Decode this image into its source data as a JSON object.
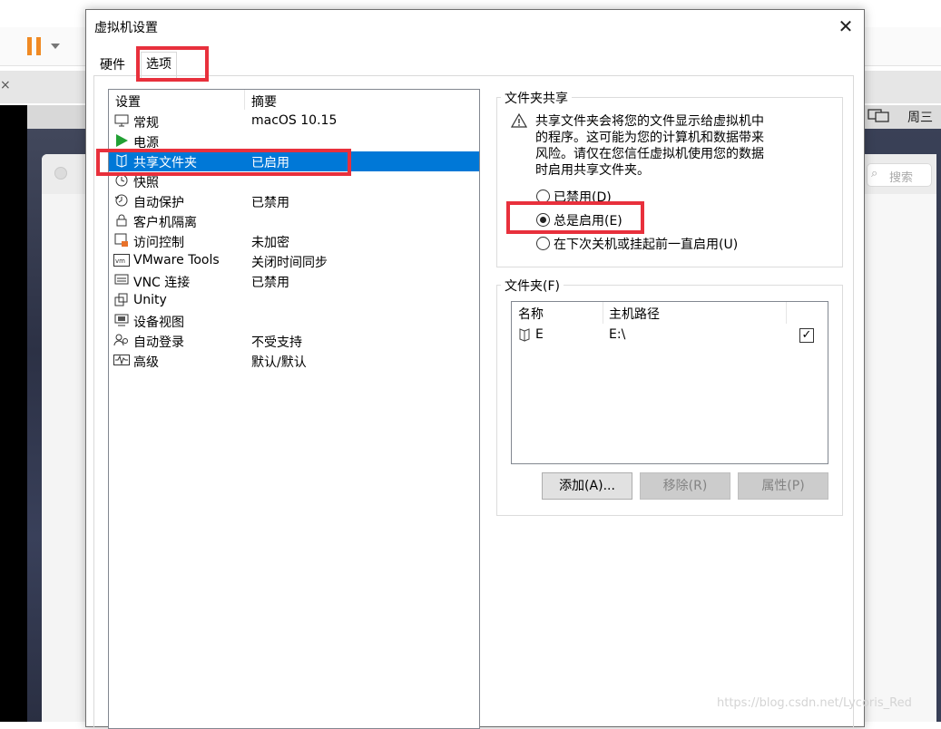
{
  "background": {
    "tab_close_glyph": "×",
    "apple_glyph": "",
    "weekday": "周三",
    "search_placeholder": "搜索"
  },
  "dialog": {
    "title": "虚拟机设置",
    "close_glyph": "✕",
    "tabs": [
      {
        "label": "硬件",
        "active": false
      },
      {
        "label": "选项",
        "active": true
      }
    ],
    "settings_list": {
      "headers": {
        "setting": "设置",
        "summary": "摘要"
      },
      "rows": [
        {
          "icon": "monitor-icon",
          "name": "常规",
          "summary": "macOS 10.15",
          "selected": false
        },
        {
          "icon": "power-play-icon",
          "name": "电源",
          "summary": "",
          "selected": false
        },
        {
          "icon": "shared-folder-icon",
          "name": "共享文件夹",
          "summary": "已启用",
          "selected": true
        },
        {
          "icon": "snapshot-clock-icon",
          "name": "快照",
          "summary": "",
          "selected": false
        },
        {
          "icon": "autoprotect-clock-icon",
          "name": "自动保护",
          "summary": "已禁用",
          "selected": false
        },
        {
          "icon": "lock-icon",
          "name": "客户机隔离",
          "summary": "",
          "selected": false
        },
        {
          "icon": "access-control-icon",
          "name": "访问控制",
          "summary": "未加密",
          "selected": false
        },
        {
          "icon": "vmware-tools-icon",
          "name": "VMware Tools",
          "summary": "关闭时间同步",
          "selected": false
        },
        {
          "icon": "vnc-icon",
          "name": "VNC 连接",
          "summary": "已禁用",
          "selected": false
        },
        {
          "icon": "unity-icon",
          "name": "Unity",
          "summary": "",
          "selected": false
        },
        {
          "icon": "device-view-icon",
          "name": "设备视图",
          "summary": "",
          "selected": false
        },
        {
          "icon": "autologin-users-icon",
          "name": "自动登录",
          "summary": "不受支持",
          "selected": false
        },
        {
          "icon": "advanced-waveform-icon",
          "name": "高级",
          "summary": "默认/默认",
          "selected": false
        }
      ]
    },
    "folder_sharing": {
      "group_label": "文件夹共享",
      "warning_icon": "warning-icon",
      "warning_text": [
        "共享文件夹会将您的文件显示给虚拟机中",
        "的程序。这可能为您的计算机和数据带来",
        "风险。请仅在您信任虚拟机使用您的数据",
        "时启用共享文件夹。"
      ],
      "options": [
        {
          "label": "已禁用(D)",
          "checked": false
        },
        {
          "label": "总是启用(E)",
          "checked": true
        },
        {
          "label": "在下次关机或挂起前一直启用(U)",
          "checked": false
        }
      ]
    },
    "folders": {
      "group_label": "文件夹(F)",
      "headers": {
        "name": "名称",
        "host_path": "主机路径"
      },
      "rows": [
        {
          "icon": "folder-share-icon",
          "name": "E",
          "host_path": "E:\\",
          "enabled": true,
          "check_glyph": "✓"
        }
      ],
      "buttons": {
        "add": {
          "label": "添加(A)...",
          "enabled": true
        },
        "remove": {
          "label": "移除(R)",
          "enabled": false
        },
        "properties": {
          "label": "属性(P)",
          "enabled": false
        }
      }
    }
  },
  "watermark": "https://blog.csdn.net/Lycoris_Red",
  "colors": {
    "selection": "#0078d7",
    "highlight_box": "#e8303c",
    "pause_orange": "#f08a24"
  }
}
